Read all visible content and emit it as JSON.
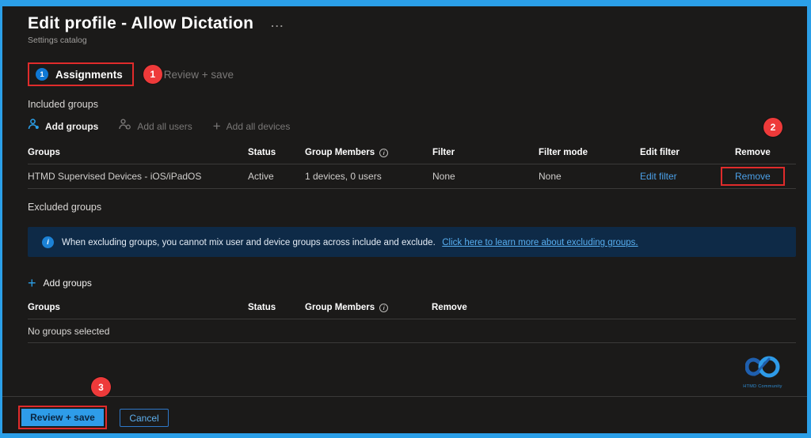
{
  "colors": {
    "frame_border": "#2b9fe8",
    "accent_blue": "#0f78d4",
    "link_blue": "#4ba0e8",
    "annotation_red": "#e02b2b",
    "banner_bg": "#0e2a47",
    "background": "#1b1a19"
  },
  "header": {
    "title": "Edit profile - Allow Dictation",
    "subtitle": "Settings catalog",
    "ellipsis": "..."
  },
  "tabs": {
    "assignments": {
      "step": "1",
      "label": "Assignments"
    },
    "review": {
      "label": "Review + save"
    }
  },
  "annotations": {
    "badge1": "1",
    "badge2": "2",
    "badge3": "3"
  },
  "included": {
    "heading": "Included groups",
    "toolbar": [
      {
        "label": "Add groups"
      },
      {
        "label": "Add all users"
      },
      {
        "label": "Add all devices"
      }
    ],
    "table": {
      "headers": [
        "Groups",
        "Status",
        "Group Members",
        "Filter",
        "Filter mode",
        "Edit filter",
        "Remove"
      ],
      "rows": [
        {
          "group": "HTMD Supervised Devices - iOS/iPadOS",
          "status": "Active",
          "members": "1 devices, 0 users",
          "filter": "None",
          "filter_mode": "None",
          "edit_filter": "Edit filter",
          "remove": "Remove"
        }
      ]
    }
  },
  "excluded": {
    "heading": "Excluded groups",
    "info_text": "When excluding groups, you cannot mix user and device groups across include and exclude.",
    "info_link": "Click here to learn more about excluding groups.",
    "add_groups_label": "Add groups",
    "table": {
      "headers": [
        "Groups",
        "Status",
        "Group Members",
        "Remove"
      ],
      "empty_text": "No groups selected"
    }
  },
  "logo": {
    "caption": "HTMD Community"
  },
  "footer": {
    "review_save_label": "Review + save",
    "cancel_label": "Cancel"
  }
}
